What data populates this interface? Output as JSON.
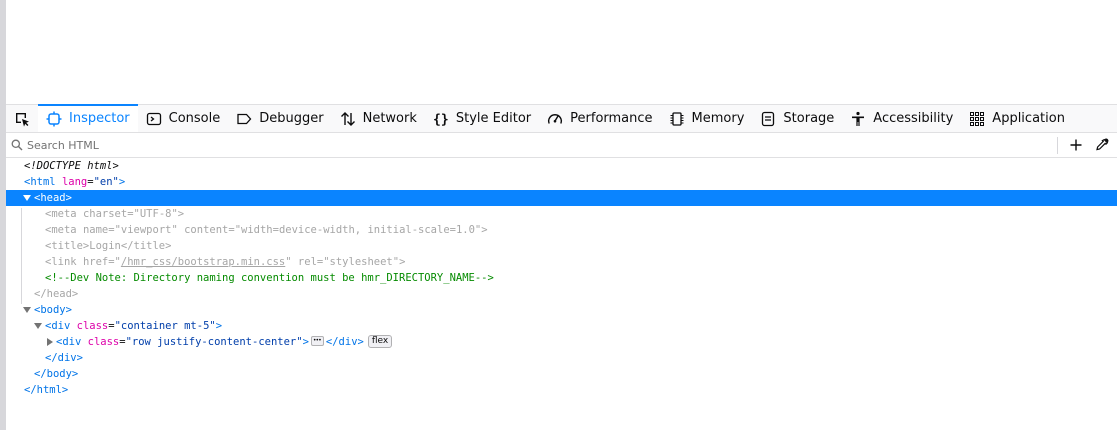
{
  "toolbar": {
    "tabs": [
      {
        "label": "Inspector",
        "icon": "inspector-icon",
        "selected": true
      },
      {
        "label": "Console",
        "icon": "console-icon"
      },
      {
        "label": "Debugger",
        "icon": "debugger-icon"
      },
      {
        "label": "Network",
        "icon": "network-icon"
      },
      {
        "label": "Style Editor",
        "icon": "style-editor-icon"
      },
      {
        "label": "Performance",
        "icon": "performance-icon"
      },
      {
        "label": "Memory",
        "icon": "memory-icon"
      },
      {
        "label": "Storage",
        "icon": "storage-icon"
      },
      {
        "label": "Accessibility",
        "icon": "accessibility-icon"
      },
      {
        "label": "Application",
        "icon": "application-icon"
      }
    ]
  },
  "search": {
    "placeholder": "Search HTML",
    "value": ""
  },
  "markup": {
    "doctype": "<!DOCTYPE html>",
    "html_open": {
      "tag": "html",
      "attr_name": "lang",
      "attr_value": "\"en\""
    },
    "head_open": "<head>",
    "meta_charset": {
      "attr_name": "charset",
      "attr_value": "\"UTF-8\""
    },
    "meta_viewport": {
      "attr1_name": "name",
      "attr1_value": "\"viewport\"",
      "attr2_name": "content",
      "attr2_value": "\"width=device-width, initial-scale=1.0\""
    },
    "title": {
      "text": "Login"
    },
    "link": {
      "href_name": "href",
      "href_value": "/hmr_css/bootstrap.min.css",
      "rel_name": "rel",
      "rel_value": "\"stylesheet\""
    },
    "comment": "<!--Dev Note: Directory naming convention must be hmr_DIRECTORY_NAME-->",
    "head_close": "</head>",
    "body_open": "<body>",
    "div_container": {
      "attr_name": "class",
      "attr_value": "\"container mt-5\""
    },
    "div_row": {
      "attr_name": "class",
      "attr_value": "\"row justify-content-center\"",
      "badge": "flex"
    },
    "div_close": "</div>",
    "body_close": "</body>",
    "html_close": "</html>"
  },
  "colors": {
    "accent": "#0a84ff",
    "tag": "#0074e8",
    "attr": "#dd00a9",
    "value": "#003eaa",
    "comment": "#058b00"
  }
}
